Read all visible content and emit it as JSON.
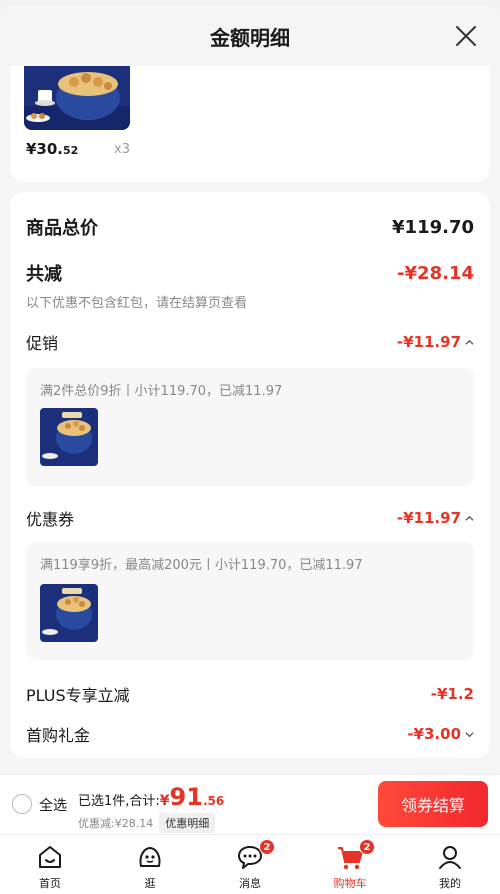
{
  "header": {
    "title": "金额明细"
  },
  "product": {
    "price_int": "¥30.",
    "price_dec": "52",
    "qty": "x3"
  },
  "summary": {
    "total_label": "商品总价",
    "total_value": "¥119.70",
    "reduce_label": "共减",
    "reduce_value": "-¥28.14",
    "note": "以下优惠不包含红包，请在结算页查看"
  },
  "promo": {
    "label": "促销",
    "value": "-¥11.97",
    "detail": "满2件总价9折丨小计119.70，已减11.97"
  },
  "coupon": {
    "label": "优惠券",
    "value": "-¥11.97",
    "detail": "满119享9折，最高减200元丨小计119.70，已减11.97"
  },
  "plus": {
    "label": "PLUS专享立减",
    "value": "-¥1.2"
  },
  "first_gift": {
    "label": "首购礼金",
    "value": "-¥3.00"
  },
  "bottom": {
    "select_all": "全选",
    "selected_text": "已选1件,合计:",
    "yen": "¥",
    "total_int": "91",
    "total_dec": ".56",
    "discount_text": "优惠减:¥28.14",
    "detail_chip": "优惠明细",
    "checkout": "领券结算"
  },
  "tabs": [
    {
      "label": "首页",
      "icon": "home-icon"
    },
    {
      "label": "逛",
      "icon": "browse-icon"
    },
    {
      "label": "消息",
      "icon": "message-icon",
      "badge": "2"
    },
    {
      "label": "购物车",
      "icon": "cart-icon",
      "badge": "2"
    },
    {
      "label": "我的",
      "icon": "profile-icon"
    }
  ],
  "colors": {
    "accent": "#e63328",
    "background": "#f5f5f5"
  }
}
